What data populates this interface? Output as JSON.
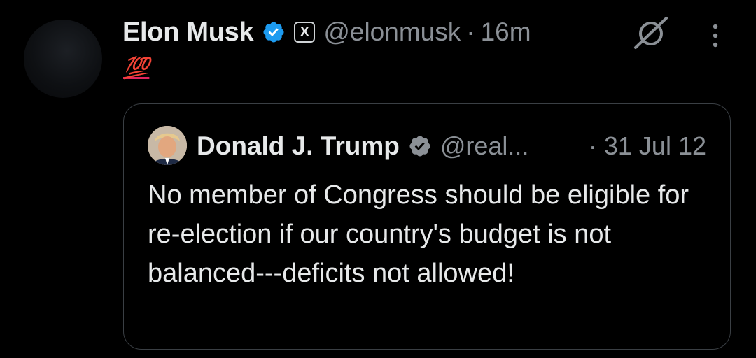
{
  "tweet": {
    "author_name": "Elon Musk",
    "handle": "@elonmusk",
    "separator": "·",
    "time": "16m",
    "badge_letter": "X",
    "text": "💯"
  },
  "icons": {
    "verified": "verified-badge-icon",
    "affiliate": "x-affiliate-icon",
    "grok": "grok-icon",
    "more": "more-vertical-icon"
  },
  "quote": {
    "author_name": "Donald J. Trump",
    "handle": "@real...",
    "time": "· 31 Jul 12",
    "text": "No member of Congress should be eligible for re-election if our country's budget is not balanced---deficits not allowed!"
  },
  "colors": {
    "background": "#000000",
    "text": "#e7e9ea",
    "muted": "#8b9096",
    "verified": "#1d9bf0",
    "border": "#3a3f44"
  }
}
